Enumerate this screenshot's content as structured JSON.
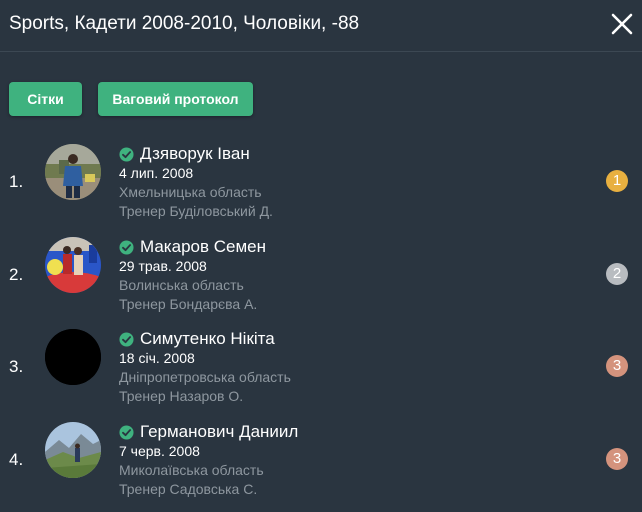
{
  "header": {
    "title": "Sports, Кадети 2008-2010, Чоловіки, -88"
  },
  "buttons": {
    "grids_label": "Сітки",
    "protocol_label": "Ваговий протокол"
  },
  "athletes": [
    {
      "num": "1.",
      "name": "Дзяворук Іван",
      "dob": "4 лип. 2008",
      "region": "Хмельницька область",
      "coach": "Тренер Буділовський Д.",
      "place": "1",
      "place_color": "#e8b040",
      "avatar": "photo-athlete-standing"
    },
    {
      "num": "2.",
      "name": "Макаров Семен",
      "dob": "29 трав. 2008",
      "region": "Волинська область",
      "coach": "Тренер Бондарєва А.",
      "place": "2",
      "place_color": "#b8bcc0",
      "avatar": "photo-wrestling-mat"
    },
    {
      "num": "3.",
      "name": "Симутенко Нікіта",
      "dob": "18 січ. 2008",
      "region": "Дніпропетровська область",
      "coach": "Тренер Назаров О.",
      "place": "3",
      "place_color": "#d4937d",
      "avatar": "photo-black"
    },
    {
      "num": "4.",
      "name": "Германович Даниил",
      "dob": "7 черв. 2008",
      "region": "Миколаївська область",
      "coach": "Тренер Садовська С.",
      "place": "3",
      "place_color": "#d4937d",
      "avatar": "photo-mountains"
    }
  ],
  "colors": {
    "background": "#2a3540",
    "accent": "#3fb27f",
    "muted_text": "#8e979f"
  }
}
